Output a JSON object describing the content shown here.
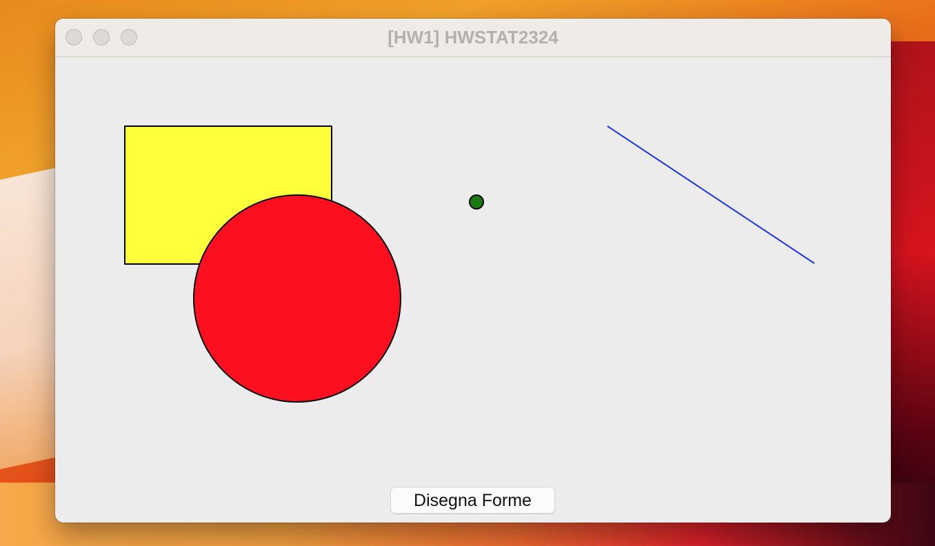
{
  "window": {
    "title": "[HW1] HWSTAT2324"
  },
  "controls": {
    "draw_button_label": "Disegna Forme"
  },
  "shapes": {
    "rectangle": {
      "fill": "#ffff3b",
      "stroke": "#000000"
    },
    "circle": {
      "fill": "#fc0f1f",
      "stroke": "#000000"
    },
    "point": {
      "fill": "#1a7a12",
      "stroke": "#000000"
    },
    "line": {
      "stroke": "#1430ff"
    }
  },
  "colors": {
    "window_background": "#ececec",
    "titlebar_background": "#efebe8",
    "title_text": "#b3b0ae"
  }
}
